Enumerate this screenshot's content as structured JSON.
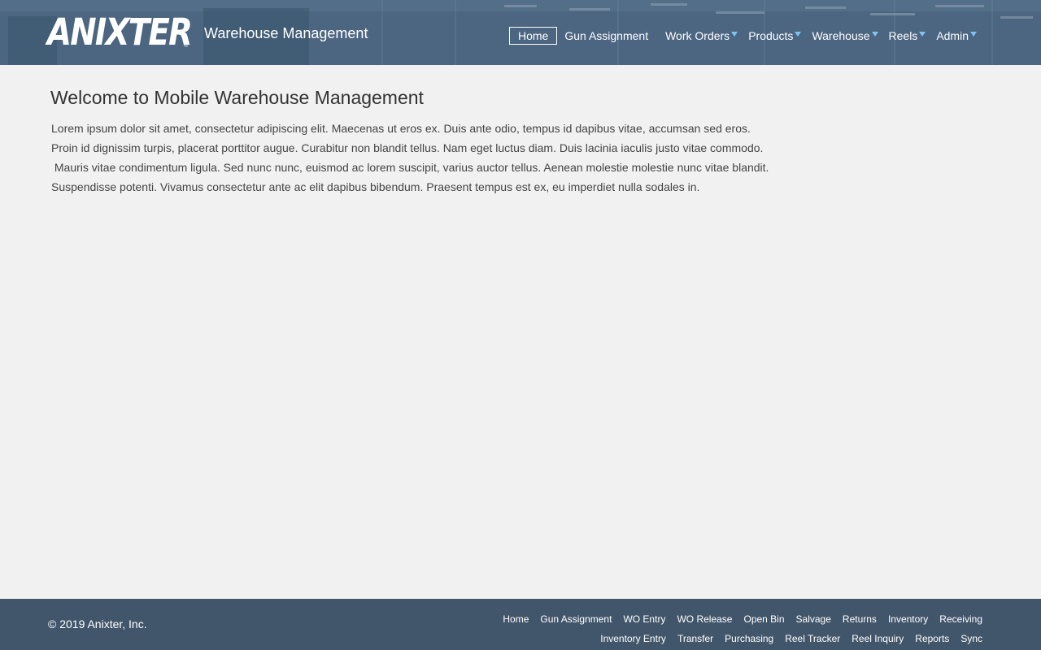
{
  "header": {
    "logo_text": "ANIXTER",
    "logo_mark": "®",
    "app_title": "Warehouse Management",
    "nav": [
      {
        "label": "Home",
        "active": true,
        "dropdown": false
      },
      {
        "label": "Gun Assignment",
        "active": false,
        "dropdown": false
      },
      {
        "label": "Work Orders",
        "active": false,
        "dropdown": true
      },
      {
        "label": "Products",
        "active": false,
        "dropdown": true
      },
      {
        "label": "Warehouse",
        "active": false,
        "dropdown": true
      },
      {
        "label": "Reels",
        "active": false,
        "dropdown": true
      },
      {
        "label": "Admin",
        "active": false,
        "dropdown": true
      }
    ]
  },
  "main": {
    "title": "Welcome to Mobile Warehouse Management",
    "paragraph_lines": [
      "Lorem ipsum dolor sit amet, consectetur adipiscing elit. Maecenas ut eros ex. Duis ante odio, tempus id dapibus vitae, accumsan sed eros.",
      "Proin id dignissim turpis, placerat porttitor augue. Curabitur non blandit tellus. Nam eget luctus diam. Duis lacinia iaculis justo vitae commodo.",
      " Mauris vitae condimentum ligula. Sed nunc nunc, euismod ac lorem suscipit, varius auctor tellus. Aenean molestie molestie nunc vitae blandit.",
      "Suspendisse potenti. Vivamus consectetur ante ac elit dapibus bibendum. Praesent tempus est ex, eu imperdiet nulla sodales in."
    ]
  },
  "footer": {
    "copyright": "© 2019 Anixter, Inc.",
    "links_row1": [
      "Home",
      "Gun Assignment",
      "WO Entry",
      "WO Release",
      "Open Bin",
      "Salvage",
      "Returns",
      "Inventory",
      "Receiving"
    ],
    "links_row2": [
      "Inventory Entry",
      "Transfer",
      "Purchasing",
      "Reel Tracker",
      "Reel Inquiry",
      "Reports",
      "Sync"
    ]
  },
  "colors": {
    "header_bg": "#58748f",
    "footer_bg": "#42566b",
    "page_bg": "#f1f1f1",
    "caret": "#7cc4f2",
    "title_text": "#333333",
    "body_text": "#444444"
  }
}
